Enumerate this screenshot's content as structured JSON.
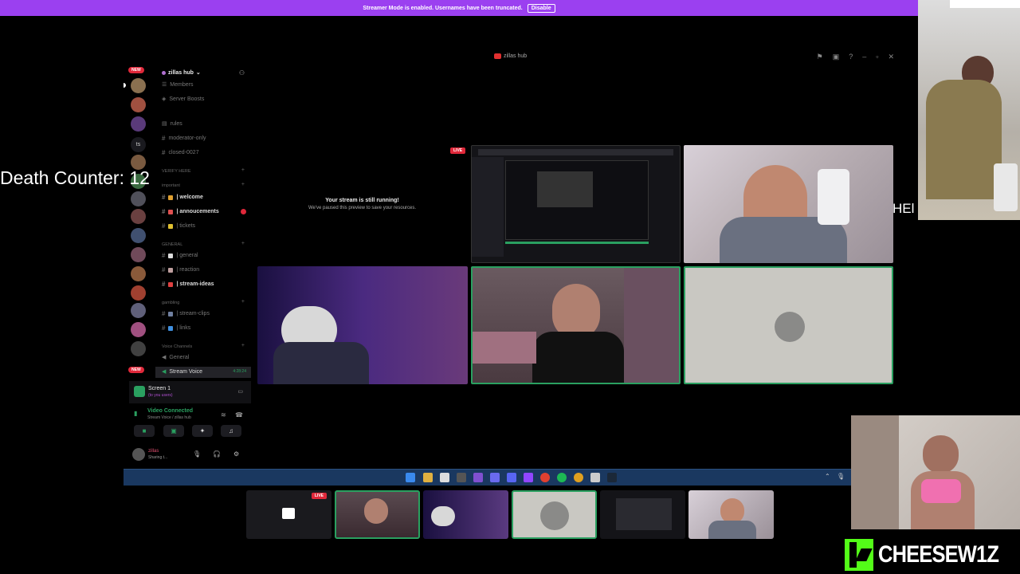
{
  "banner": {
    "message": "Streamer Mode is enabled. Usernames have been truncated.",
    "button": "Disable"
  },
  "window": {
    "title": "zillas hub"
  },
  "rail": {
    "new_badge_top": "NEW",
    "new_badge_bottom": "NEW",
    "text_server": "ts"
  },
  "server": {
    "name": "zillas hub"
  },
  "channels": {
    "members": "Members",
    "server_boosts": "Server Boosts",
    "rules": "rules",
    "moderator_only": "moderator-only",
    "closed": "closed-0027",
    "cat_verify": "VERIFY HERE",
    "cat_important": "important",
    "welcome": "| welcome",
    "announcements": "| annoucements",
    "tickets": "| tickets",
    "cat_general": "GENERAL",
    "general": "| general",
    "reaction": "| reaction",
    "stream_ideas": "| stream-ideas",
    "cat_gambling": "gambling",
    "stream_clips": "| stream-clips",
    "links": "| links",
    "cat_voice": "Voice Channels",
    "voice_general": "General",
    "voice_stream": "Stream Voice",
    "voice_time": "4:28:24"
  },
  "screen_share": {
    "title": "Screen 1",
    "subtitle": "(to you users)"
  },
  "voice_status": {
    "title": "Video Connected",
    "subtitle": "Stream Voice / zillas hub"
  },
  "user": {
    "name": "zillas",
    "status": "Sharing t..."
  },
  "stream": {
    "paused_title": "Your stream is still running!",
    "paused_sub": "We've paused this preview to save your resources.",
    "live_label": "LIVE"
  },
  "overlay": {
    "death_counter": "Death Counter: 12",
    "partial_text": "HEl"
  },
  "thumbs": {
    "live_label": "LIVE"
  },
  "brand": {
    "name": "CHEESEW1Z",
    "color": "#53fc18"
  },
  "colors": {
    "banner": "#9b40f0",
    "speaking": "#2aa060",
    "live": "#e0283a",
    "taskbar": "#1a3860"
  }
}
